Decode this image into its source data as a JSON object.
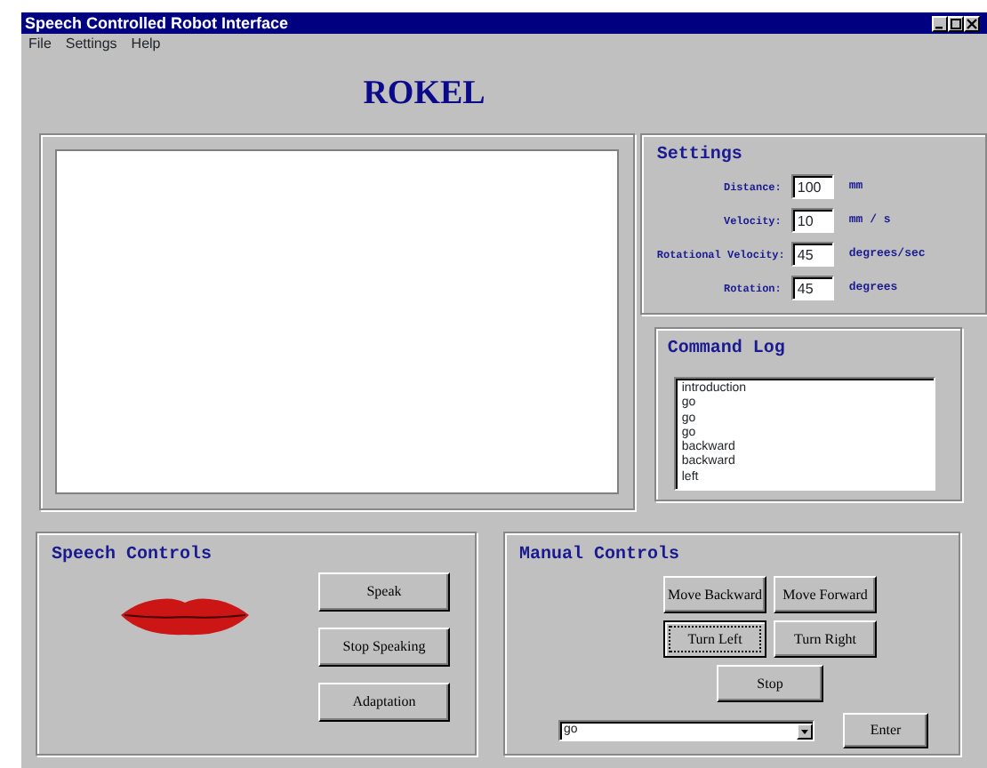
{
  "window": {
    "title": "Speech Controlled Robot Interface"
  },
  "menu": [
    "File",
    "Settings",
    "Help"
  ],
  "heading": "ROKEL",
  "settings": {
    "title": "Settings",
    "fields": [
      {
        "label": "Distance:",
        "value": "100",
        "unit": "mm"
      },
      {
        "label": "Velocity:",
        "value": "10",
        "unit": "mm / s"
      },
      {
        "label": "Rotational Velocity:",
        "value": "45",
        "unit": "degrees/sec"
      },
      {
        "label": "Rotation:",
        "value": "45",
        "unit": "degrees"
      }
    ]
  },
  "command_log": {
    "title": "Command Log",
    "items": [
      "introduction",
      "go",
      "go",
      "go",
      "backward",
      "backward",
      "left"
    ]
  },
  "speech_controls": {
    "title": "Speech Controls",
    "buttons": [
      "Speak",
      "Stop Speaking",
      "Adaptation"
    ]
  },
  "manual_controls": {
    "title": "Manual Controls",
    "buttons": [
      {
        "label": "Move Backward",
        "focused": false
      },
      {
        "label": "Move Forward",
        "focused": false
      },
      {
        "label": "Turn Left",
        "focused": true
      },
      {
        "label": "Turn Right",
        "focused": false
      },
      {
        "label": "Stop",
        "focused": false
      }
    ],
    "command_select": {
      "value": "go"
    },
    "enter_button": "Enter"
  }
}
